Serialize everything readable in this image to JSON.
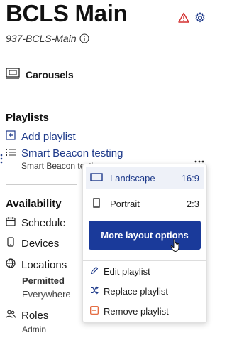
{
  "header": {
    "title": "BCLS Main",
    "subtitle": "937-BCLS-Main"
  },
  "carousels": {
    "label": "Carousels"
  },
  "playlists": {
    "title": "Playlists",
    "add_label": "Add playlist",
    "item_label": "Smart Beacon testing",
    "item_sub": "Smart Beacon testing"
  },
  "availability": {
    "title": "Availability",
    "schedule": "Schedule",
    "devices": "Devices",
    "locations": "Locations",
    "permitted": "Permitted",
    "everywhere": "Everywhere",
    "roles": "Roles",
    "admin": "Admin"
  },
  "dropdown": {
    "landscape_label": "Landscape",
    "landscape_ratio": "16:9",
    "portrait_label": "Portrait",
    "portrait_ratio": "2:3",
    "more_label": "More layout options",
    "edit_label": "Edit playlist",
    "replace_label": "Replace playlist",
    "remove_label": "Remove playlist"
  },
  "colors": {
    "accent": "#1e3a8a",
    "warning": "#d32f2f",
    "remove": "#e05a2b"
  }
}
